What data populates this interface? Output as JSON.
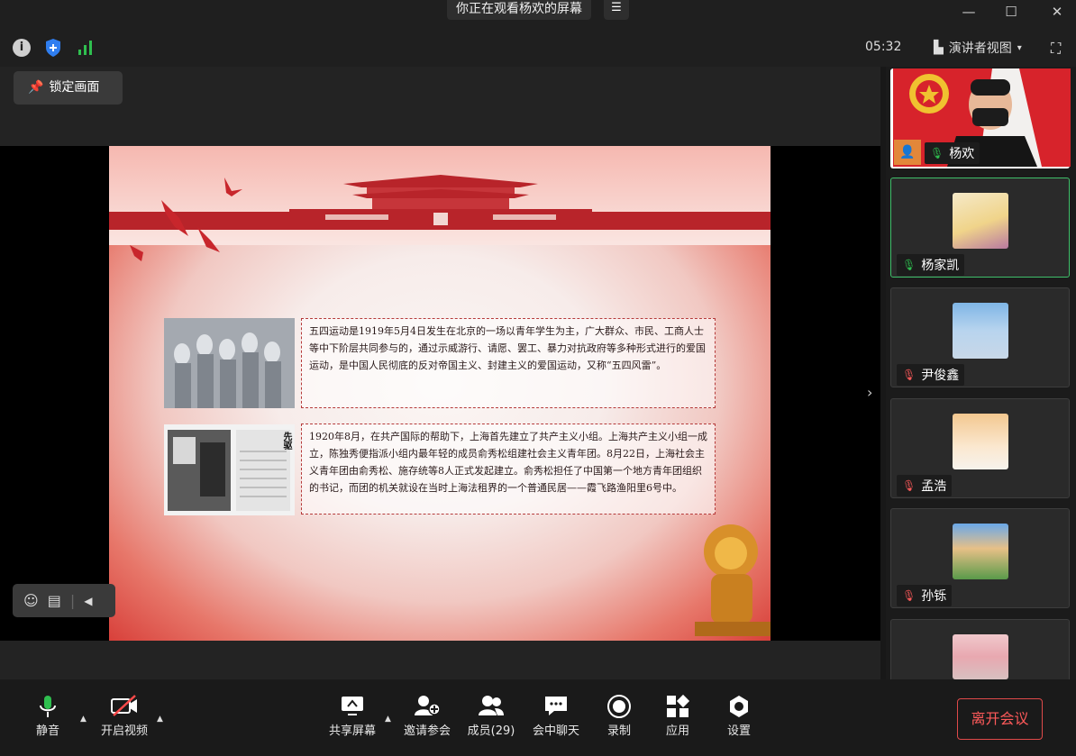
{
  "titlebar": {
    "viewing_text": "你正在观看杨欢的屏幕",
    "menu_icon": "menu-icon",
    "minimize": "—",
    "maximize": "☐",
    "close": "✕"
  },
  "status": {
    "timer": "05:32",
    "view_mode": "演讲者视图",
    "view_mode_caret": "▾",
    "info_icon": "info-icon",
    "shield_icon": "shield-icon",
    "signal_icon": "signal-icon"
  },
  "lock_button": {
    "label": "锁定画面"
  },
  "slide": {
    "paragraph1": "五四运动是1919年5月4日发生在北京的一场以青年学生为主，广大群众、市民、工商人士等中下阶层共同参与的，通过示威游行、请愿、罢工、暴力对抗政府等多种形式进行的爱国运动，是中国人民彻底的反对帝国主义、封建主义的爱国运动，又称“五四风雷”。",
    "paragraph2": "1920年8月，在共产国际的帮助下，上海首先建立了共产主义小组。上海共产主义小组一成立，陈独秀便指派小组内最年轻的成员俞秀松组建社会主义青年团。8月22日，上海社会主义青年团由俞秀松、施存统等8人正式发起建立。俞秀松担任了中国第一个地方青年团组织的书记，而团的机关就设在当时上海法租界的一个普通民居——霞飞路渔阳里6号中。",
    "newspaper_title": "先驱"
  },
  "participants": [
    {
      "name": "杨欢",
      "mic": "on",
      "role": "host"
    },
    {
      "name": "杨家凯",
      "mic": "on"
    },
    {
      "name": "尹俊鑫",
      "mic": "muted"
    },
    {
      "name": "孟浩",
      "mic": "muted"
    },
    {
      "name": "孙铄",
      "mic": "muted"
    },
    {
      "name": "",
      "mic": "muted"
    }
  ],
  "toolbar": {
    "mute": "静音",
    "video": "开启视频",
    "share": "共享屏幕",
    "invite": "邀请参会",
    "members": "成员(29)",
    "chat": "会中聊天",
    "record": "录制",
    "apps": "应用",
    "settings": "设置",
    "leave": "离开会议"
  },
  "colors": {
    "accent": "#e04a4a",
    "slide_red": "#b8242a",
    "active_border": "#3fbf6a",
    "mic_green": "#2fbf4f"
  }
}
